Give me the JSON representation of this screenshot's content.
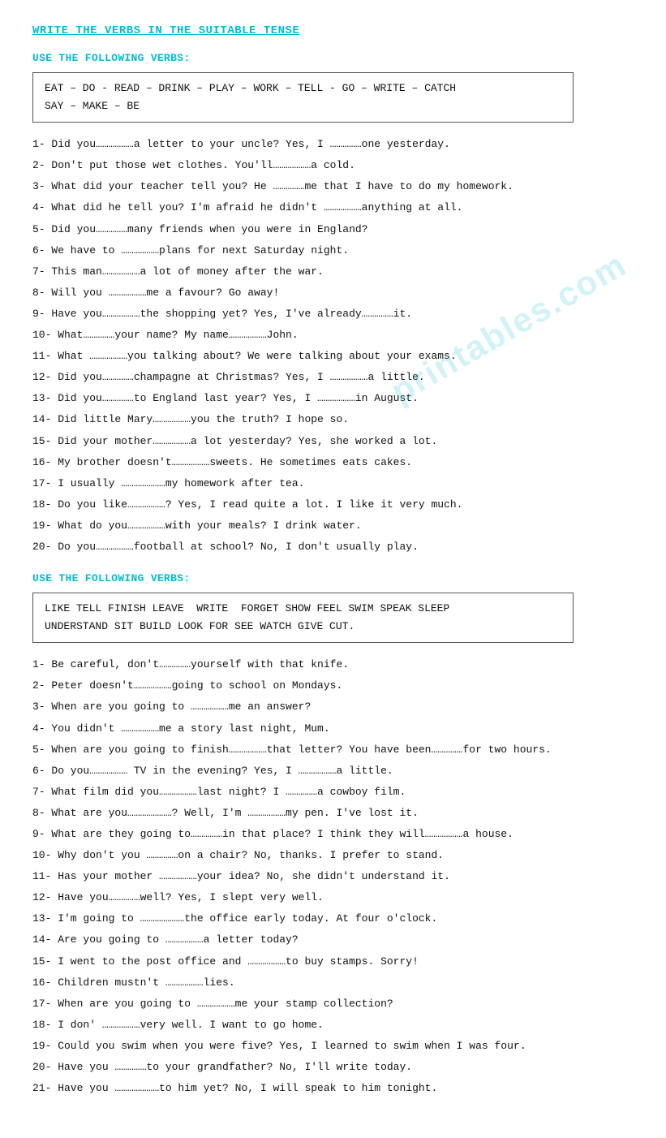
{
  "page": {
    "title": "WRITE THE VERBS IN THE SUITABLE TENSE",
    "section1": {
      "label": "USE THE FOLLOWING VERBS:",
      "verbs": "EAT – DO - READ – DRINK – PLAY – WORK – TELL -  GO – WRITE – CATCH\nSAY – MAKE – BE",
      "exercises": [
        "1-   Did you………………a letter to your uncle? Yes, I ……………one yesterday.",
        "2-   Don't put those wet clothes. You'll………………a cold.",
        "3-   What did your teacher tell you? He ……………me that I have to do my homework.",
        "4-   What did he tell you? I'm afraid he didn't ………………anything at all.",
        "5-   Did you……………many friends when you were in England?",
        "6-   We have to ………………plans for next Saturday night.",
        "7-   This man………………a lot of money after the war.",
        "8-   Will you ………………me a favour? Go away!",
        "9-   Have you………………the shopping yet? Yes, I've already……………it.",
        "10-  What……………your name? My name………………John.",
        "11-  What ………………you talking about? We were talking about your exams.",
        "12-  Did you……………champagne at Christmas? Yes, I ………………a little.",
        "13-  Did you……………to England last year? Yes, I ………………in August.",
        "14-  Did little Mary………………you the truth? I hope so.",
        "15-  Did your mother………………a lot yesterday? Yes, she worked a lot.",
        "16-  My brother doesn't………………sweets. He sometimes eats cakes.",
        "17-  I usually …………………my homework after tea.",
        "18-  Do you like………………? Yes, I read quite a lot. I like it very much.",
        "19-  What do you………………with your meals? I drink water.",
        "20-  Do you………………football at school? No, I don't usually play."
      ]
    },
    "section2": {
      "label": "USE THE FOLLOWING VERBS:",
      "verbs": "LIKE TELL FINISH LEAVE  WRITE  FORGET SHOW FEEL SWIM SPEAK SLEEP\nUNDERSTAND SIT BUILD LOOK FOR SEE WATCH GIVE CUT.",
      "exercises": [
        "1-   Be careful, don't……………yourself with that knife.",
        "2-   Peter doesn't………………going to school on Mondays.",
        "3-   When are you going to ………………me an answer?",
        "4-   You didn't ………………me a story last night, Mum.",
        "5-   When are you going to finish………………that letter? You have been……………for two hours.",
        "6-   Do you……………… TV in the evening? Yes, I ………………a little.",
        "7-   What film did you………………last night? I ……………a cowboy film.",
        "8-   What are you…………………? Well, I'm ………………my pen. I've lost it.",
        "9-   What are they going to……………in that place? I think they will………………a house.",
        "10-  Why don't you ……………on a chair? No, thanks. I prefer to stand.",
        "11-  Has your mother ………………your idea? No, she didn't understand it.",
        "12-  Have you……………well? Yes, I slept very well.",
        "13-  I'm going to …………………the office early today. At four o'clock.",
        "14-  Are you going to ………………a letter today?",
        "15-  I went to the post office and ………………to buy stamps. Sorry!",
        "16-  Children mustn't ………………lies.",
        "17-  When are you going to ………………me your stamp collection?",
        "18-  I don' ………………very well. I want to go home.",
        "19-  Could you swim when you were five? Yes, I learned to swim when I was four.",
        "20-  Have you ……………to your grandfather? No, I'll write today.",
        "21-  Have you …………………to him yet? No, I will speak to him tonight."
      ]
    }
  },
  "watermark": "printables.com"
}
